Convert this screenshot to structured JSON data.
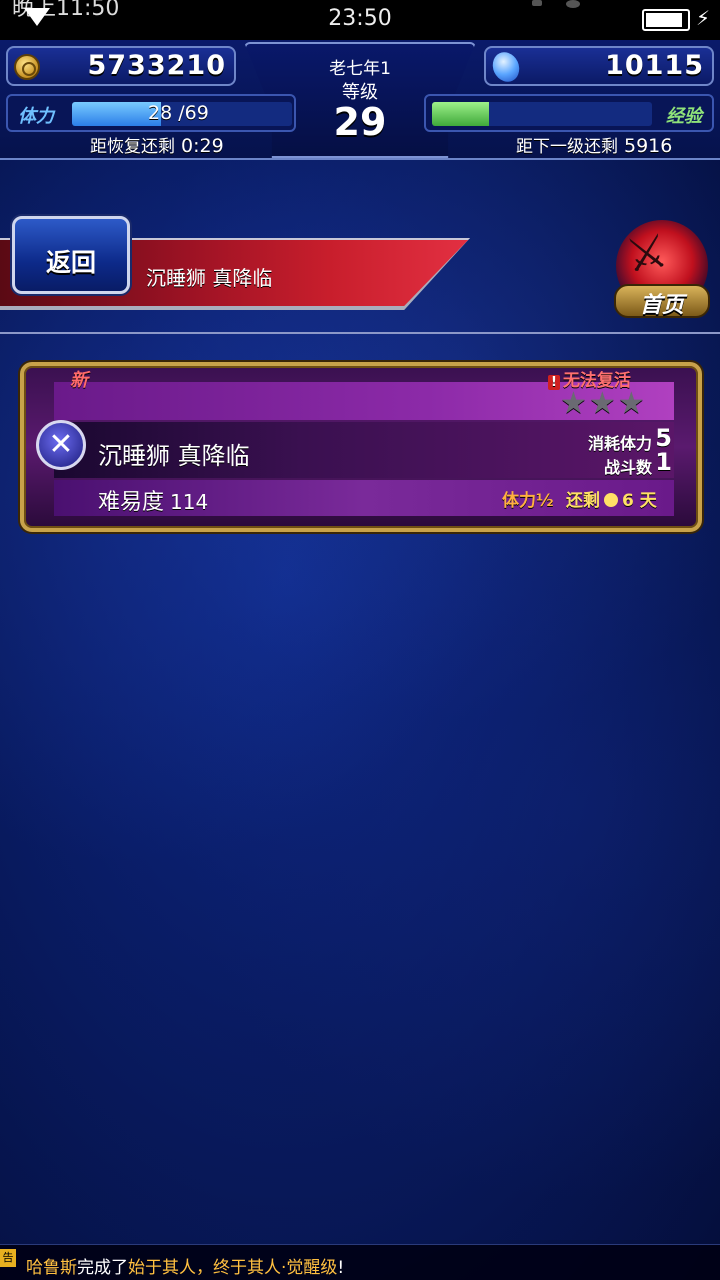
{
  "status_bar": {
    "clock_left": "晚上11:50",
    "clock_center": "23:50"
  },
  "header": {
    "gil": "5733210",
    "gems": "10115",
    "player_name": "老七年1",
    "level_label": "等级",
    "level": "29",
    "stamina_label": "体力",
    "stamina_text": "28 /69",
    "stamina_fraction": 0.406,
    "recover_label": "距恢复还剩",
    "recover_time": "0:29",
    "exp_label": "经验",
    "exp_fraction": 0.26,
    "next_level_label": "距下一级还剩",
    "next_level_value": "5916"
  },
  "nav": {
    "back_label": "返回",
    "page_title": "沉睡狮 真降临",
    "home_label": "首页"
  },
  "quest": {
    "new_label": "新",
    "no_revive_label": "无法复活",
    "name": "沉睡狮 真降临",
    "difficulty_label": "难易度",
    "difficulty_value": "114",
    "stamina_cost_label": "消耗体力",
    "stamina_cost": "5",
    "battles_label": "战斗数",
    "battles": "1",
    "half_stamina_label": "体力½",
    "remaining_label": "还剩",
    "remaining_value": "6 天",
    "stars_total": 3,
    "stars_earned": 0
  },
  "ticker": {
    "tag": "告",
    "player": "哈鲁斯",
    "middle": "完成了",
    "quest": "始于其人，终于其人·觉醒级",
    "end": "!"
  },
  "colors": {
    "background": "#0a1f6e",
    "ribbon_red": "#c81e2c",
    "card_gold": "#c8a24a",
    "card_purple": "#5a1a6e"
  }
}
